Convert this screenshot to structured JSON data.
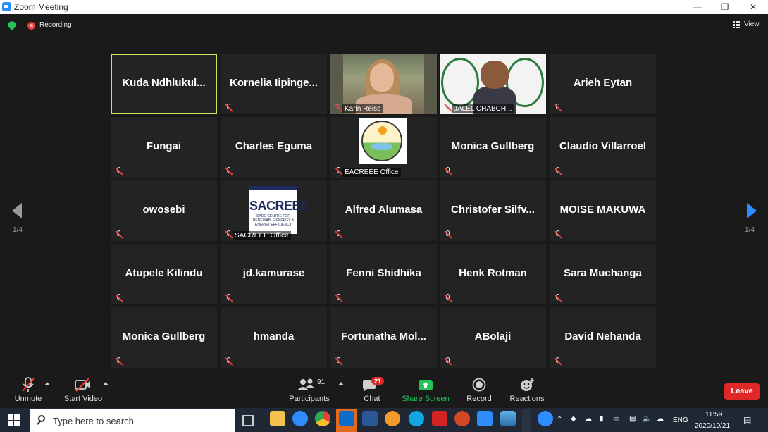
{
  "window": {
    "title": "Zoom Meeting",
    "minimize": "—",
    "restore": "❐",
    "close": "✕"
  },
  "meeting": {
    "recording_label": "Recording",
    "view_label": "View"
  },
  "tiles": [
    {
      "name": "Kuda  Ndhlukul...",
      "active": true
    },
    {
      "name": "Kornelia  Iipinge..."
    },
    {
      "name": "",
      "caption": "Karin Reiss"
    },
    {
      "name": "",
      "caption": "JALEL CHABCH..."
    },
    {
      "name": "Arieh Eytan"
    },
    {
      "name": "Fungai"
    },
    {
      "name": "Charles Eguma"
    },
    {
      "name": "",
      "caption": "EACREEE Office"
    },
    {
      "name": "Monica Gullberg"
    },
    {
      "name": "Claudio Villarroel"
    },
    {
      "name": "owosebi"
    },
    {
      "name": "",
      "caption": "SACREEE Office",
      "logo_text": "SACREEE",
      "logo_sub": "SADC CENTRE FOR RENEWABLE ENERGY & ENERGY EFFICIENCY"
    },
    {
      "name": "Alfred Alumasa"
    },
    {
      "name": "Christofer  Silfv..."
    },
    {
      "name": "MOISE MAKUWA"
    },
    {
      "name": "Atupele Kilindu"
    },
    {
      "name": "jd.kamurase"
    },
    {
      "name": "Fenni Shidhika"
    },
    {
      "name": "Henk Rotman"
    },
    {
      "name": "Sara Muchanga"
    },
    {
      "name": "Monica Gullberg"
    },
    {
      "name": "hmanda"
    },
    {
      "name": "Fortunatha  Mol..."
    },
    {
      "name": "ABolaji"
    },
    {
      "name": "David Nehanda"
    }
  ],
  "pagination": {
    "left": "1/4",
    "right": "1/4"
  },
  "toolbar": {
    "unmute": "Unmute",
    "start_video": "Start Video",
    "participants": "Participants",
    "participants_count": "91",
    "chat": "Chat",
    "chat_badge": "21",
    "share_screen": "Share Screen",
    "record": "Record",
    "reactions": "Reactions",
    "leave": "Leave"
  },
  "taskbar": {
    "search_placeholder": "Type here to search",
    "language": "ENG",
    "time": "11:59",
    "date": "2020/10/21"
  },
  "colors": {
    "active_speaker": "#c8e65a",
    "leave": "#e02828",
    "share": "#23c35a",
    "zoom_blue": "#2d8cff"
  }
}
